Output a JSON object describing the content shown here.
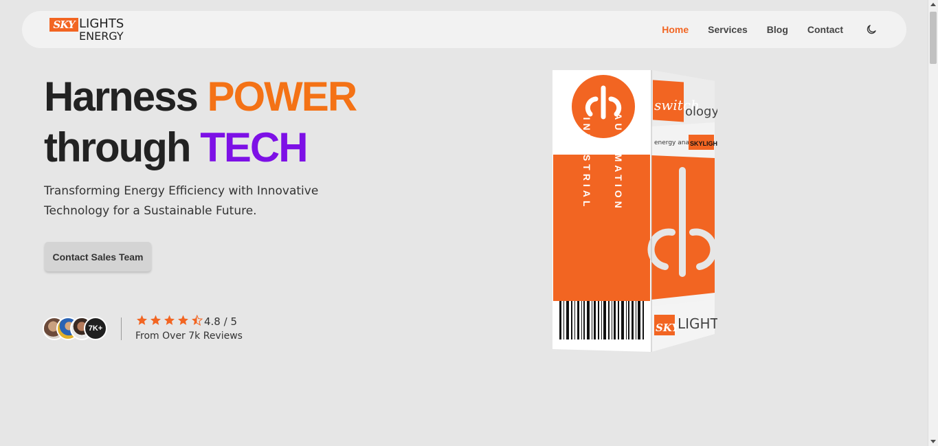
{
  "brand": {
    "logo_sky": "SKY",
    "logo_lights": "LIGHTS",
    "logo_energy": "ENERGY"
  },
  "nav": {
    "items": [
      {
        "label": "Home",
        "active": true
      },
      {
        "label": "Services",
        "active": false
      },
      {
        "label": "Blog",
        "active": false
      },
      {
        "label": "Contact",
        "active": false
      }
    ],
    "theme_toggle_icon": "moon-icon"
  },
  "hero": {
    "headline_part1": "Harness ",
    "headline_power": "POWER",
    "headline_part2": "through ",
    "headline_tech": "TECH",
    "subtitle": "Transforming Energy Efficiency with Innovative Technology for a Sustainable Future.",
    "cta_label": "Contact Sales Team"
  },
  "reviews": {
    "avatar_more": "7K+",
    "rating_value": 4.8,
    "rating_text": "4.8 / 5",
    "caption": "From Over 7k Reviews",
    "stars_full": 4,
    "stars_half": 1
  },
  "product": {
    "side_text_1": "INDUSTRIAL",
    "side_text_2": "AUTOMATION",
    "brand_top": "switch",
    "brand_top_suffix": "ology",
    "tagline": "energy analytics",
    "tagline_brand": "SKYLIGHTS",
    "bottom_brand_sky": "SKY",
    "bottom_brand_lights": "LIGHTS"
  },
  "colors": {
    "accent_orange": "#f26522",
    "power_orange": "#f47216",
    "tech_purple": "#7d10e6",
    "background": "#e6e6e6"
  }
}
